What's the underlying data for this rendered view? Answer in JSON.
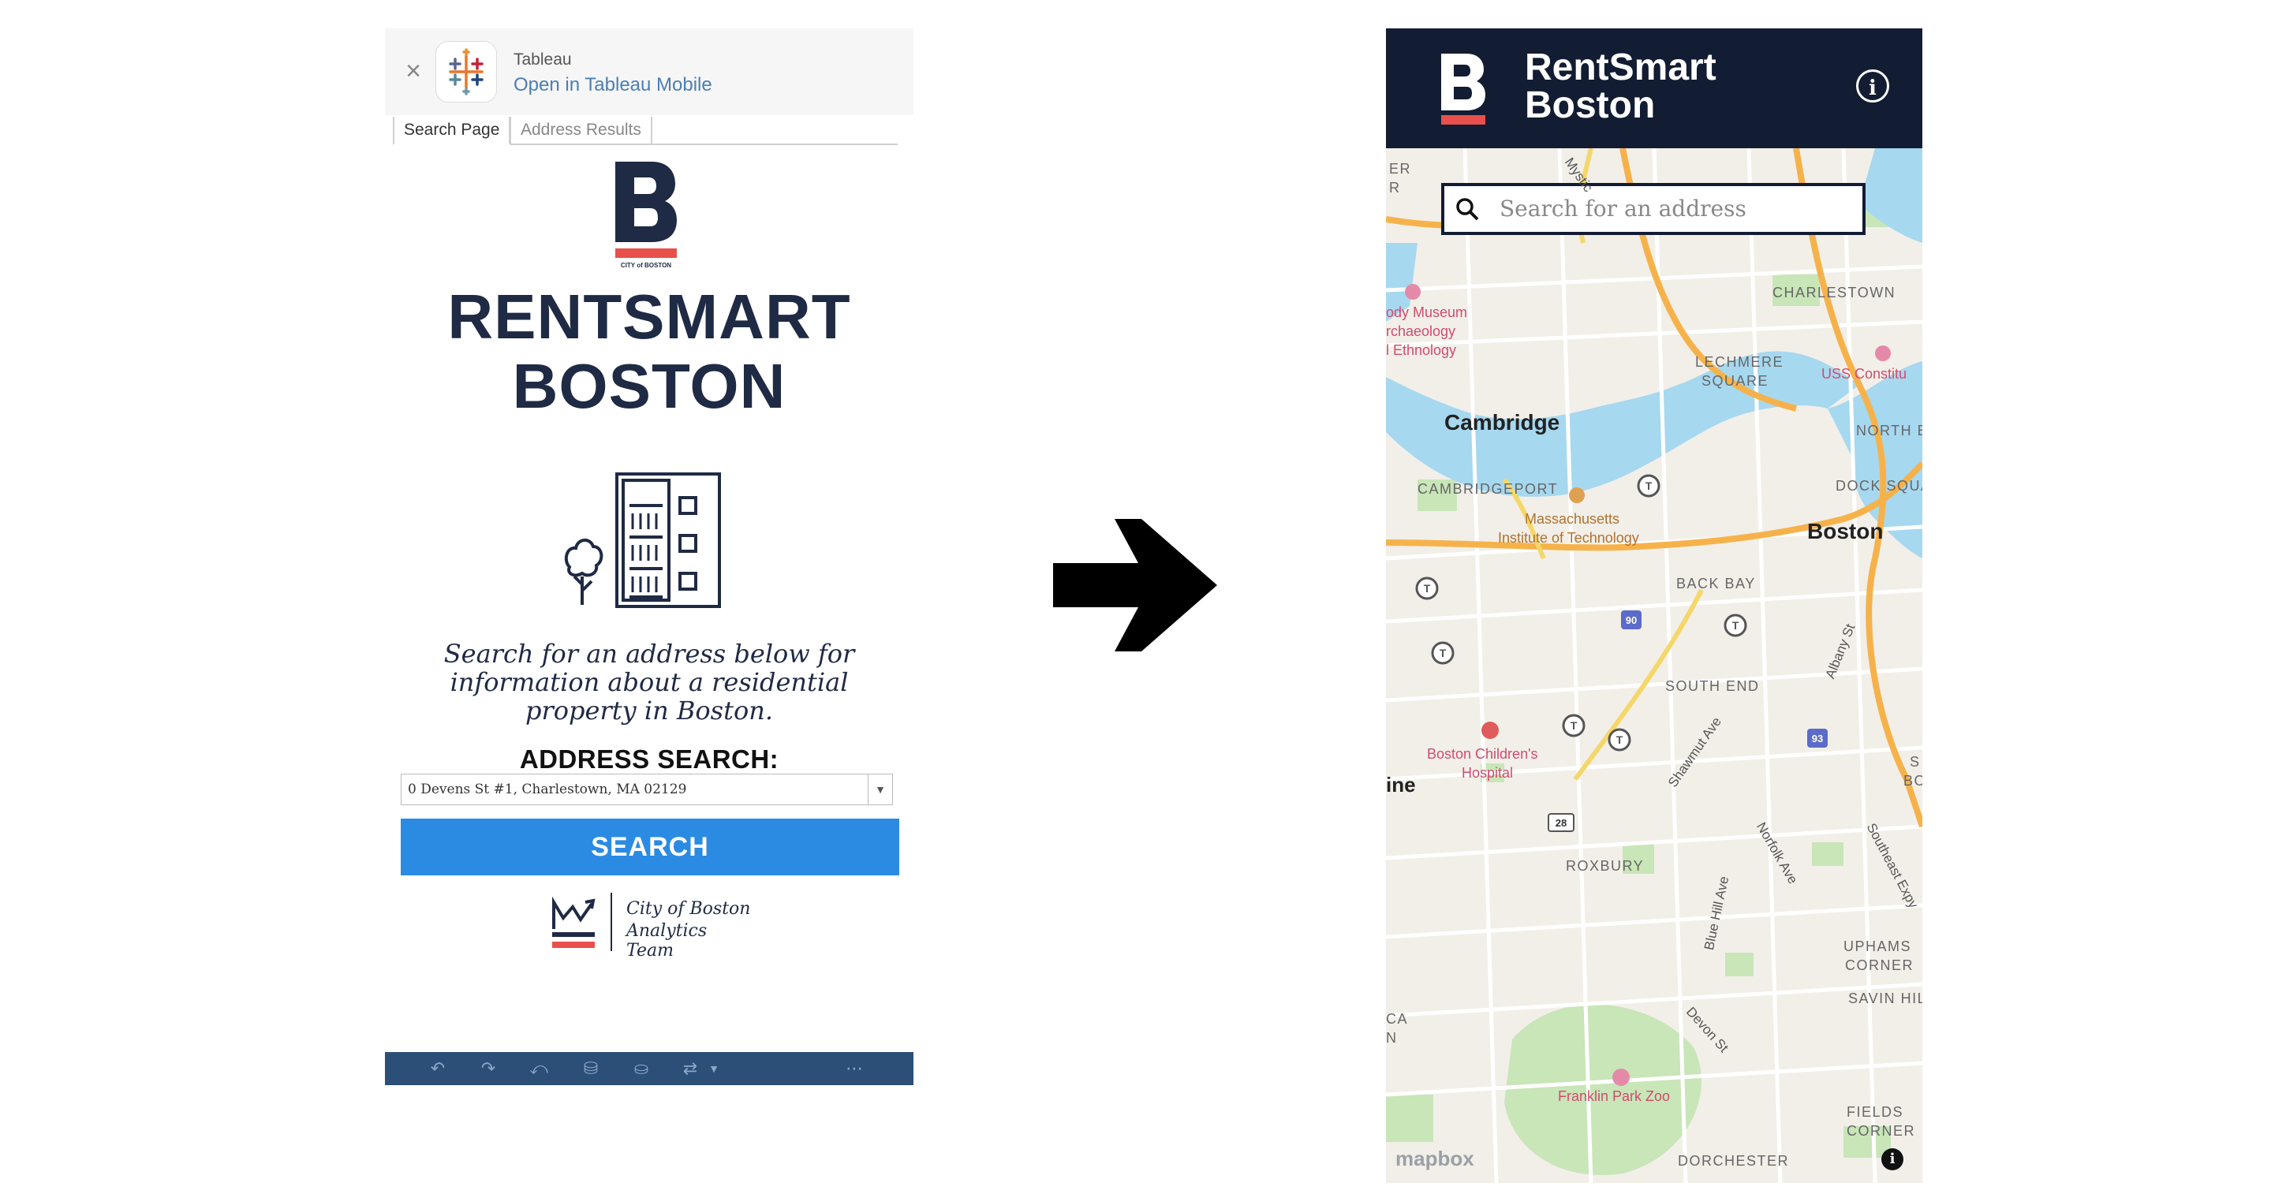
{
  "left_app": {
    "banner": {
      "app_name": "Tableau",
      "open_link": "Open in Tableau Mobile",
      "close_icon": "close-icon",
      "app_icon": "tableau-icon"
    },
    "tabs": [
      {
        "label": "Search Page"
      },
      {
        "label": "Address Results"
      }
    ],
    "logo": {
      "caption": "CITY of BOSTON",
      "accent_color": "#e8504c"
    },
    "title_line1": "RENTSMART",
    "title_line2": "BOSTON",
    "description": "Search for an address below for information about a residential property in Boston.",
    "address_label": "ADDRESS SEARCH:",
    "address_value": "0 Devens St #1, Charlestown, MA 02129",
    "search_button": "SEARCH",
    "analytics_line1": "City of Boston",
    "analytics_line2": "Analytics Team",
    "toolbar_icons": [
      "undo-icon",
      "redo-icon",
      "revert-icon",
      "refresh-data-icon",
      "pause-data-icon",
      "share-icon",
      "more-icon"
    ],
    "colors": {
      "navy": "#1f2a44",
      "button": "#2b8be3",
      "toolbar": "#2c4f78"
    }
  },
  "right_app": {
    "header": {
      "title_line1": "RentSmart",
      "title_line2": "Boston",
      "info_icon": "info-icon"
    },
    "search": {
      "placeholder": "Search for an address"
    },
    "map_labels": {
      "charlestown": "CHARLESTOWN",
      "museum1": "ody Museum",
      "museum2": "rchaeology",
      "museum3": "l Ethnology",
      "lechmere1": "LECHMERE",
      "lechmere2": "SQUARE",
      "uss": "USS Constitu",
      "cambridge": "Cambridge",
      "north_e": "NORTH E",
      "cambridgeport": "CAMBRIDGEPORT",
      "dock": "DOCK SQUAR",
      "mit1": "Massachusetts",
      "mit2": "Institute of Technology",
      "boston": "Boston",
      "backbay": "BACK BAY",
      "southend": "SOUTH END",
      "albany": "Albany St",
      "childrens1": "Boston Children's",
      "childrens2": "Hospital",
      "shawmut": "Shawmut Ave",
      "ine": "ine",
      "roxbury": "ROXBURY",
      "norfolk": "Norfolk Ave",
      "southeast": "Southeast Expy",
      "bluehill": "Blue Hill Ave",
      "uphams1": "UPHAMS",
      "uphams2": "CORNER",
      "savin": "SAVIN HILL",
      "devon": "Devon St",
      "ca": "CA",
      "n": "N",
      "franklin": "Franklin Park Zoo",
      "fields1": "FIELDS",
      "fields2": "CORNER",
      "dorchester": "DORCHESTER",
      "er": "ER",
      "r": "R",
      "mystic": "Mystic",
      "s_edge": "S",
      "bo_edge": "BO"
    },
    "highway_shields": [
      "90",
      "93",
      "28"
    ],
    "attribution": "mapbox",
    "attribution_info_icon": "info-icon",
    "colors": {
      "header": "#121d33",
      "water": "#a6d8f0",
      "park": "#c8e6b8",
      "highway": "#f6b24a",
      "accent": "#e8504c"
    }
  },
  "arrow": {
    "icon": "arrow-right-icon"
  }
}
